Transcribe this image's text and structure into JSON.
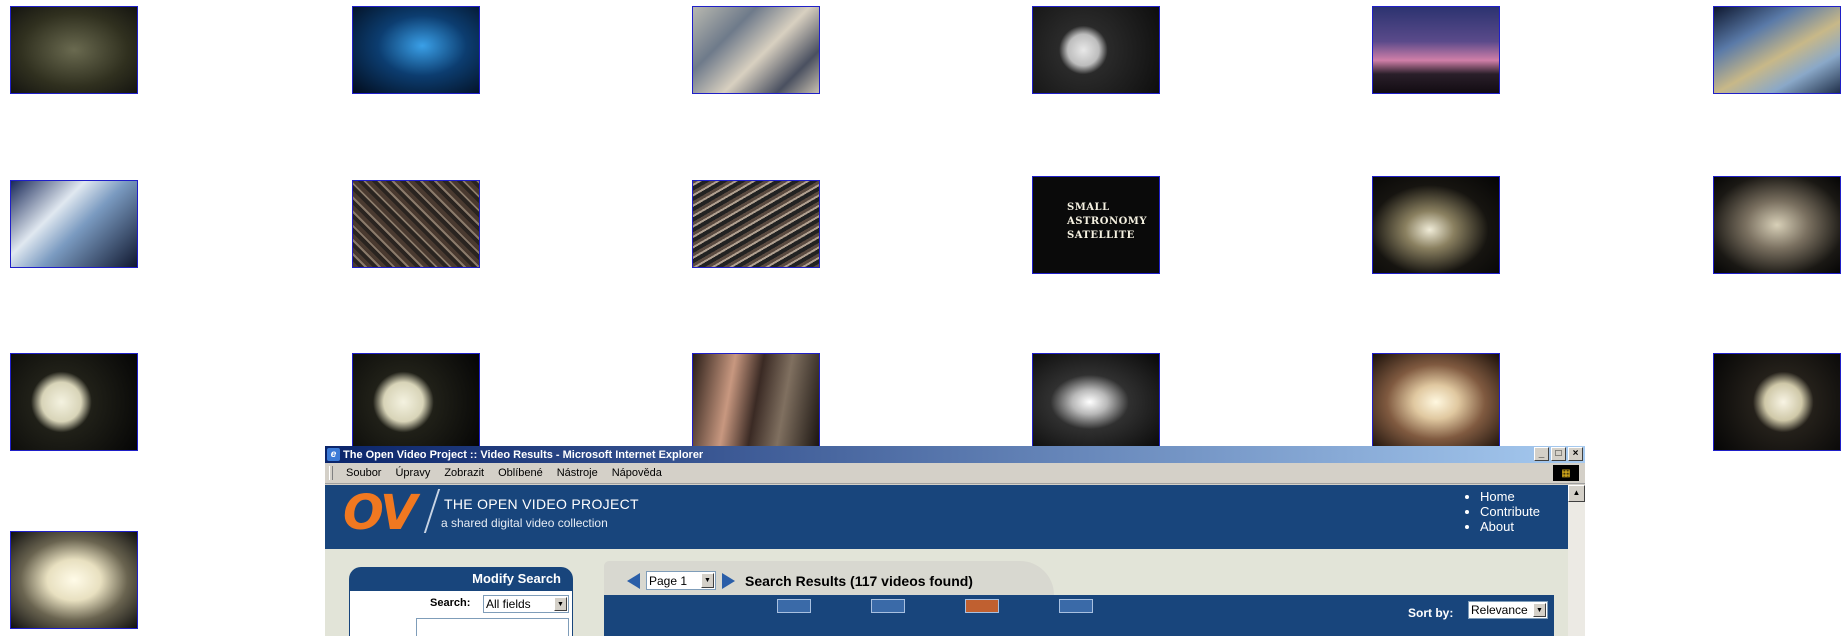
{
  "thumbnails": {
    "sign_caption": [
      "SMALL",
      "ASTRONOMY",
      "SATELLITE"
    ]
  },
  "window": {
    "title": "The Open Video Project :: Video Results - Microsoft Internet Explorer",
    "controls": [
      "_",
      "□",
      "×"
    ],
    "menu": [
      "Soubor",
      "Úpravy",
      "Zobrazit",
      "Oblíbené",
      "Nástroje",
      "Nápověda"
    ]
  },
  "site": {
    "logo": "OV",
    "title": "THE OPEN VIDEO PROJECT",
    "subtitle": "a shared digital video collection",
    "nav": [
      "Home",
      "Contribute",
      "About"
    ]
  },
  "sidebar": {
    "heading": "Modify Search",
    "search_label": "Search:",
    "search_scope": "All fields"
  },
  "results": {
    "page_select": "Page 1",
    "summary": "Search Results (117 videos found)",
    "sort_label": "Sort by:",
    "sort_value": "Relevance",
    "view_modes": [
      "list-view-icon",
      "detail-view-icon",
      "storyboard-view-icon",
      "rated-view-icon"
    ]
  }
}
